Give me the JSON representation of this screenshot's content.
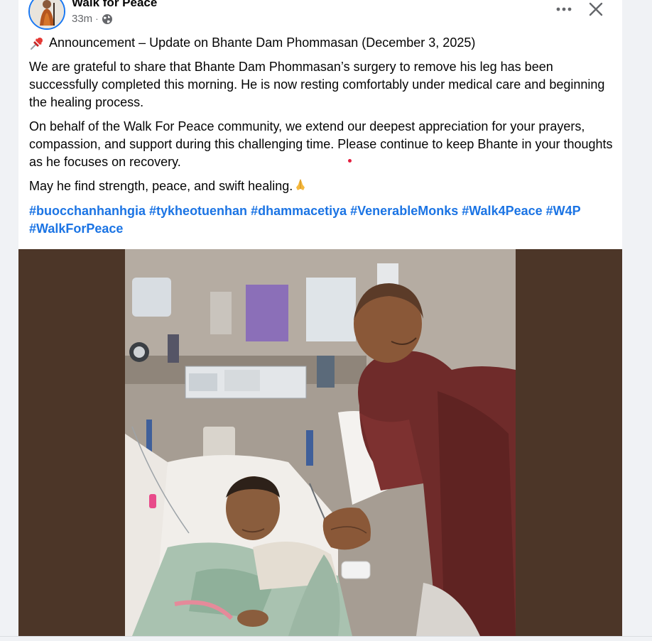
{
  "post": {
    "author": "Walk for Peace",
    "time": "33m",
    "separator": "·",
    "privacy_icon": "globe-icon",
    "more_icon": "more-icon",
    "close_icon": "close-icon",
    "title": "Announcement – Update on Bhante Dam Phommasan (December 3, 2025)",
    "title_icon": "pushpin-icon",
    "paragraphs": [
      "We are grateful to share that Bhante Dam Phommasan’s surgery to remove his leg has been successfully completed this morning. He is now resting comfortably under medical care and beginning the healing process.",
      "On behalf of the Walk For Peace community, we extend our deepest appreciation for your prayers, compassion, and support during this challenging time. Please continue to keep Bhante in your thoughts as he focuses on recovery."
    ],
    "closing": "May he find strength, peace, and swift healing.",
    "closing_icon": "praying-hands-icon",
    "hashtags": [
      "#buocchanhanhgia",
      "#tykheotuenhan",
      "#dhammacetiya",
      "#VenerableMonks",
      "#Walk4Peace",
      "#W4P",
      "#WalkForPeace"
    ],
    "photo": "hospital-photo"
  },
  "colors": {
    "link": "#1b74e4",
    "text": "#050505",
    "meta": "#65676b",
    "photo_bg": "#4c3628",
    "avatar_ring": "#1877f2"
  }
}
